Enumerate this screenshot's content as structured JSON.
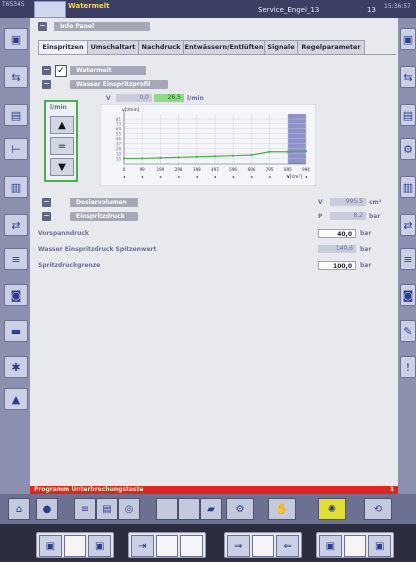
{
  "titlebar": {
    "id": "T65345",
    "app_name": "Watermelt",
    "user": "Service_Engel_13",
    "station": "13",
    "time": "15:36:57"
  },
  "info_panel": {
    "label": "Info Panel"
  },
  "tabs": [
    {
      "label": "Einspritzen",
      "active": true
    },
    {
      "label": "Umschaltart",
      "active": false
    },
    {
      "label": "Nachdruck",
      "active": false
    },
    {
      "label": "Entwässern/Entlüften",
      "active": false
    },
    {
      "label": "Signale",
      "active": false
    },
    {
      "label": "Regelparameter",
      "active": false
    }
  ],
  "watermelt": {
    "label": "Watermelt",
    "checked": true
  },
  "profile": {
    "label": "Wasser Einspritzprofil",
    "speed_unit": "l/min",
    "v_label": "V",
    "v_value": "0,0",
    "v_value2": "26,5",
    "v_unit": "l/min"
  },
  "chart_data": {
    "type": "line",
    "ylabel": "v[l/min]",
    "xlabel": "V[cm³]",
    "x_ticks": [
      "0",
      "99",
      "199",
      "298",
      "398",
      "497",
      "596",
      "696",
      "795",
      "895",
      "994"
    ],
    "y_ticks": [
      "10",
      "19",
      "28",
      "37",
      "46",
      "55",
      "64",
      "73",
      "81"
    ],
    "series": [
      {
        "x": [
          0,
          99,
          199,
          298,
          398,
          497,
          596,
          696,
          795,
          895,
          994
        ],
        "y": [
          10,
          10,
          11,
          12,
          13,
          14,
          15,
          16,
          22,
          22,
          23
        ]
      }
    ],
    "ylim": [
      0,
      90
    ],
    "xlim": [
      0,
      994
    ],
    "highlight_range": [
      895,
      994
    ]
  },
  "dosier": {
    "label": "Dosiervolumen",
    "var": "V",
    "value": "995,5",
    "unit": "cm³"
  },
  "einspritzdruck": {
    "label": "Einspritzdruck",
    "var": "P",
    "value": "8,2",
    "unit": "bar"
  },
  "rows": [
    {
      "label": "Vorspanndruck",
      "value": "40,0",
      "unit": "bar",
      "editable": true
    },
    {
      "label": "Wasser Einspritzdruck Spitzenwert",
      "value": "140,6",
      "unit": "bar",
      "editable": false
    },
    {
      "label": "Spritzdruckgrenze",
      "value": "100,0",
      "unit": "bar",
      "editable": true
    }
  ],
  "status": {
    "text": "Programm Unterbrechungstaste",
    "count": "1"
  },
  "icons": {
    "left_sidebar": [
      "mold-icon",
      "injection-unit-icon",
      "temperature-icon",
      "ejector-icon",
      "core-pull-icon",
      "process-icon",
      "dosing-icon",
      "robot-icon",
      "conveyor-icon",
      "alarm-icon",
      "log-icon"
    ],
    "bottom_keys": [
      "motor-left-icon",
      "motor-right-icon",
      "mold-open-icon",
      "mold-blank-icon",
      "nozzle-forward-icon",
      "nozzle-back-icon",
      "eject-left-icon",
      "eject-right-icon"
    ]
  },
  "colors": {
    "accent": "#48b24a",
    "header": "#a5a8b7",
    "status": "#e0261c",
    "titlebar": "#3a3f63"
  }
}
